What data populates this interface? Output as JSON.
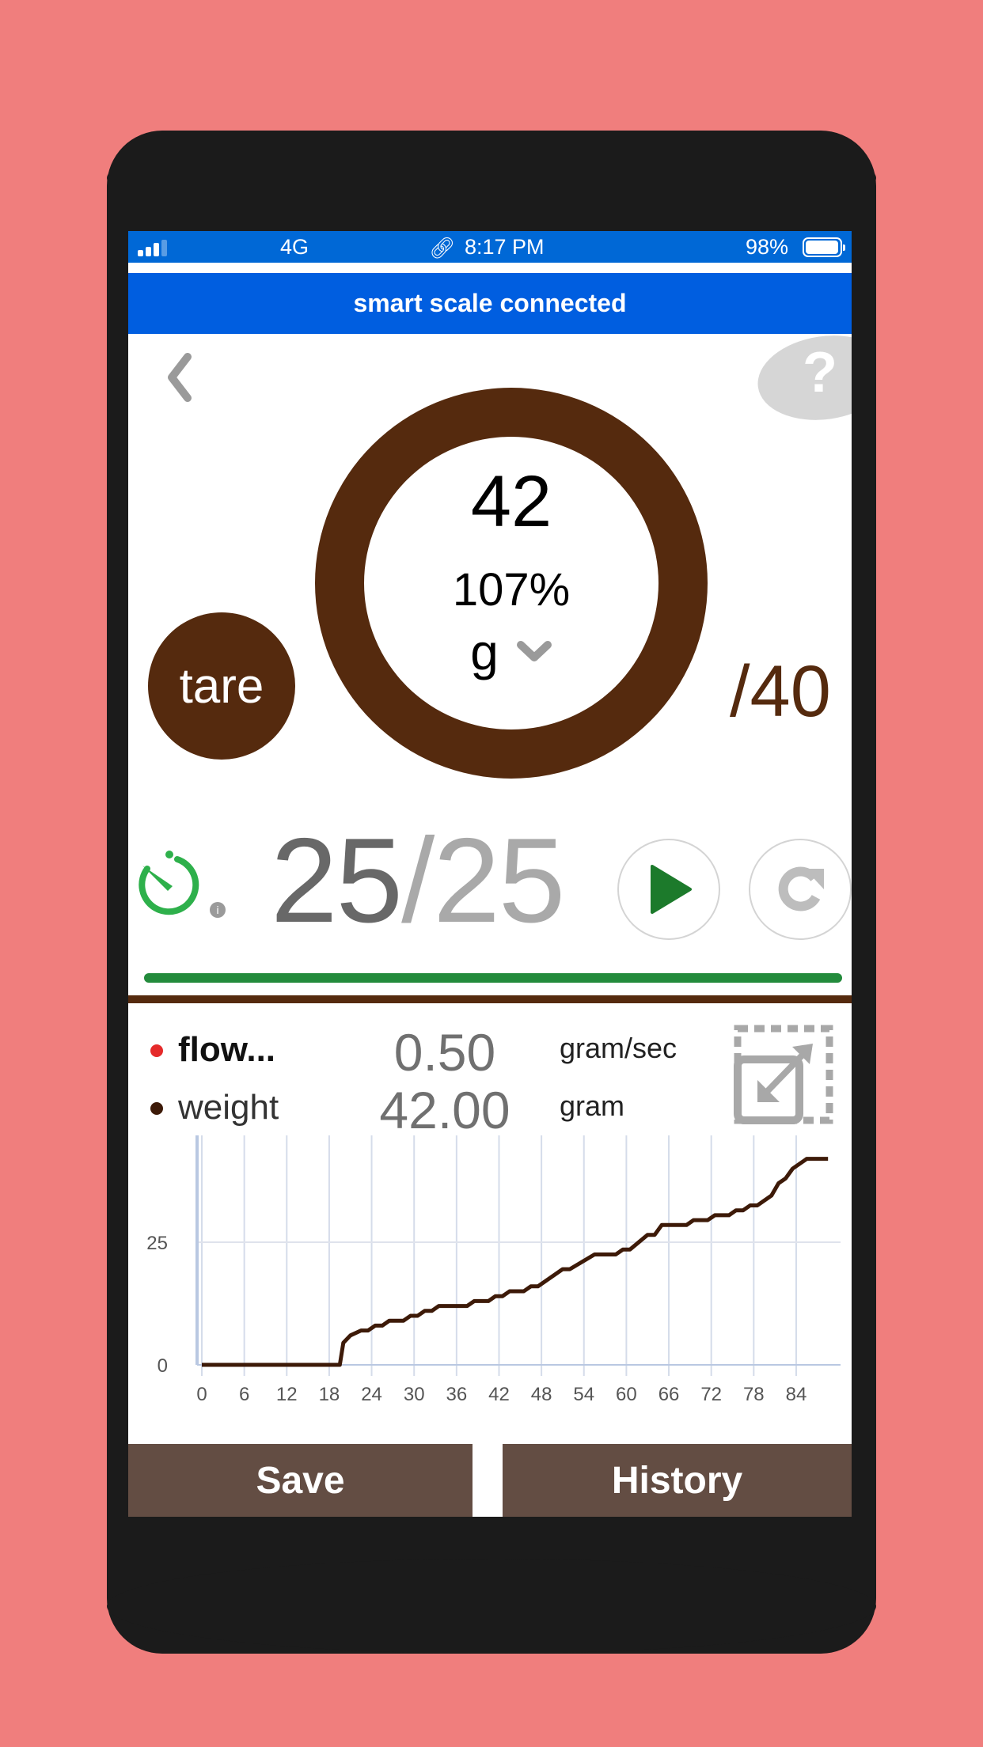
{
  "status_bar": {
    "network": "4G",
    "time": "8:17 PM",
    "battery_percent": "98%",
    "signal_bars_active": 3,
    "signal_bars_total": 4,
    "battery_level": 0.98
  },
  "banner": {
    "text": "smart scale connected"
  },
  "header": {
    "back_icon": "chevron-left-icon",
    "help_label": "?"
  },
  "gauge": {
    "weight": "42",
    "percent": "107%",
    "unit": "g",
    "ring_color": "#552a0e"
  },
  "tare": {
    "label": "tare"
  },
  "target": {
    "label": "/40"
  },
  "timer": {
    "elapsed": "25",
    "separator": "/",
    "total": "25",
    "info_label": "i",
    "progress": 1.0,
    "progress_color": "#238b3c",
    "icon_color": "#2eb04b"
  },
  "controls": {
    "play_icon": "play-icon",
    "reset_icon": "refresh-icon"
  },
  "readouts": [
    {
      "label": "flow...",
      "value": "0.50",
      "unit": "gram/sec",
      "color": "#e52a2a"
    },
    {
      "label": "weight",
      "value": "42.00",
      "unit": "gram",
      "color": "#3d1a08"
    }
  ],
  "buttons": {
    "save": "Save",
    "history": "History"
  },
  "chart_data": {
    "type": "line",
    "title": "",
    "xlabel": "",
    "ylabel": "",
    "x_ticks": [
      "0",
      "6",
      "12",
      "18",
      "24",
      "30",
      "36",
      "42",
      "48",
      "54",
      "60",
      "66",
      "72",
      "78",
      "84"
    ],
    "y_ticks": [
      "0",
      "25"
    ],
    "xlim": [
      0,
      90
    ],
    "ylim": [
      0,
      42
    ],
    "grid": true,
    "series": [
      {
        "name": "weight",
        "color": "#3d1a08",
        "x": [
          0,
          19.5,
          20,
          21,
          22.5,
          23.5,
          24.5,
          25.5,
          26.5,
          28.5,
          29.5,
          30.5,
          31.5,
          32.5,
          33.5,
          37.5,
          38.5,
          40.5,
          41.5,
          42.5,
          43.5,
          45.5,
          46.5,
          47.5,
          51,
          52,
          55.5,
          58.5,
          59.5,
          60.5,
          63,
          64,
          65,
          68.5,
          69.5,
          71.5,
          72.5,
          74.5,
          75.5,
          76.5,
          77.5,
          78.5,
          80.5,
          81.5,
          82.5,
          83.5,
          85.5,
          88.5
        ],
        "y": [
          0,
          0,
          4.5,
          6,
          7,
          7,
          8,
          8,
          9,
          9,
          10,
          10,
          11,
          11,
          12,
          12,
          13,
          13,
          14,
          14,
          15,
          15,
          16,
          16,
          19.5,
          19.5,
          22.5,
          22.5,
          23.5,
          23.5,
          26.5,
          26.5,
          28.5,
          28.5,
          29.5,
          29.5,
          30.5,
          30.5,
          31.5,
          31.5,
          32.5,
          32.5,
          34.5,
          37,
          38,
          40,
          42,
          42
        ]
      }
    ]
  }
}
